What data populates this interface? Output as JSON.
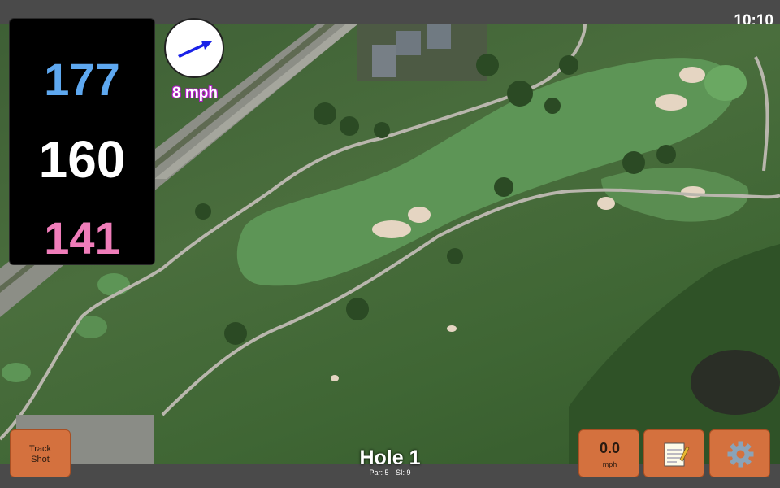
{
  "status": {
    "time": "10:10"
  },
  "distances": {
    "back": "177",
    "center": "160",
    "front": "141"
  },
  "wind": {
    "speed": "8 mph",
    "icon": "wind-direction-arrow-icon"
  },
  "hole": {
    "title": "Hole 1",
    "par": "Par: 5",
    "si": "SI: 9"
  },
  "buttons": {
    "track_shot_line1": "Track",
    "track_shot_line2": "Shot",
    "speed_value": "0.0",
    "speed_unit": "mph",
    "notes_icon": "notepad-icon",
    "settings_icon": "gear-icon"
  },
  "colors": {
    "back": "#5ea8f0",
    "center": "#ffffff",
    "front": "#f07dba",
    "button": "#d4713e",
    "wind_arrow": "#1a22e8",
    "wind_outline": "#b21cc8"
  }
}
